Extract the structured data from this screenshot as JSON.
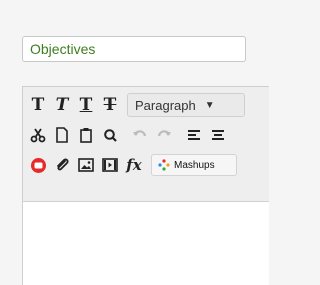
{
  "title_field": {
    "value": "Objectives"
  },
  "toolbar": {
    "row1": {
      "bold_glyph": "T",
      "italic_glyph": "T",
      "underline_glyph": "T",
      "strikethrough_glyph": "T",
      "format_dropdown": {
        "selected": "Paragraph"
      }
    },
    "row2": {
      "icons": [
        "cut-icon",
        "copy-icon",
        "paste-icon",
        "search-icon",
        "undo-icon",
        "redo-icon",
        "align-left-icon",
        "align-center-icon"
      ]
    },
    "row3": {
      "icons": [
        "record-icon",
        "attach-icon",
        "image-icon",
        "media-icon",
        "formula-icon"
      ],
      "formula_label": "fx",
      "mashups_label": "Mashups"
    }
  },
  "colors": {
    "title_text": "#3e7d1f",
    "record_red": "#e52a2a",
    "toolbar_bg": "#eeeeee"
  }
}
